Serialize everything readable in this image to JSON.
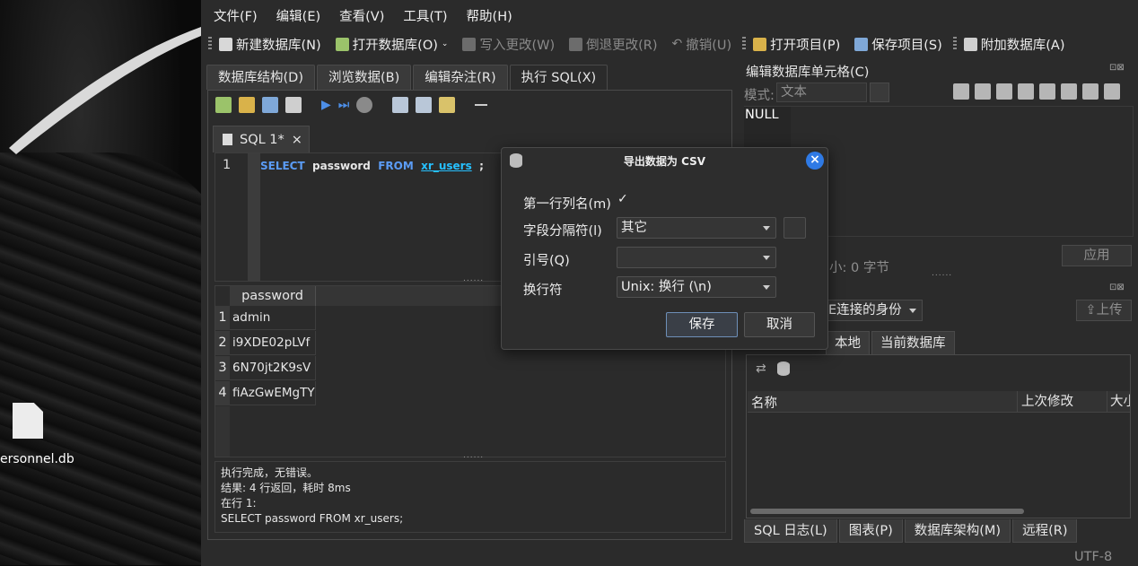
{
  "desktop": {
    "file_label": "ersonnel.db"
  },
  "menu": [
    "文件(F)",
    "编辑(E)",
    "查看(V)",
    "工具(T)",
    "帮助(H)"
  ],
  "toolbar": {
    "new_db": "新建数据库(N)",
    "open_db": "打开数据库(O)",
    "write_changes": "写入更改(W)",
    "revert_changes": "倒退更改(R)",
    "undo": "撤销(U)",
    "open_project": "打开项目(P)",
    "save_project": "保存项目(S)",
    "attach_db": "附加数据库(A)"
  },
  "main_tabs": [
    "数据库结构(D)",
    "浏览数据(B)",
    "编辑杂注(R)",
    "执行 SQL(X)"
  ],
  "sql_tab": {
    "label": "SQL 1*",
    "close": "×"
  },
  "editor": {
    "line": "1",
    "kw_select": "SELECT",
    "col": "password",
    "kw_from": "FROM",
    "table": "xr_users",
    "semicolon": ";"
  },
  "results": {
    "column": "password",
    "rows": [
      {
        "n": "1",
        "v": "admin"
      },
      {
        "n": "2",
        "v": "i9XDE02pLVf"
      },
      {
        "n": "3",
        "v": "6N70jt2K9sV"
      },
      {
        "n": "4",
        "v": "fiAzGwEMgTY"
      }
    ],
    "grip": "......"
  },
  "message": {
    "line1": "执行完成，无错误。",
    "line2": "结果: 4 行返回，耗时 8ms",
    "line3": "在行 1:",
    "line4": "SELECT password FROM xr_users;"
  },
  "right": {
    "title": "编辑数据库单元格(C)",
    "mode_label": "模式:",
    "mode_value": "文本",
    "null_value": "NULL",
    "apply": "应用",
    "size": "小: 0 字节",
    "identity": "E连接的身份",
    "upload": "上传",
    "tabs": [
      "本地",
      "当前数据库"
    ],
    "headers": {
      "name": "名称",
      "modified": "上次修改",
      "size": "大小"
    },
    "bottom_tabs": [
      "SQL 日志(L)",
      "图表(P)",
      "数据库架构(M)",
      "远程(R)"
    ],
    "encoding": "UTF-8",
    "panel_ctrls": "⊡⊠"
  },
  "dialog": {
    "title": "导出数据为 CSV",
    "close": "×",
    "header_label": "第一行列名(m)",
    "header_checked": "✓",
    "separator_label": "字段分隔符(l)",
    "separator_value": "其它",
    "quote_label": "引号(Q)",
    "quote_value": "",
    "newline_label": "换行符",
    "newline_value": "Unix: 换行 (\\n)",
    "save": "保存",
    "cancel": "取消"
  },
  "colors": {
    "keyword": "#5b9cf5",
    "table": "#26c0ff",
    "close_button": "#2f7ae5"
  }
}
